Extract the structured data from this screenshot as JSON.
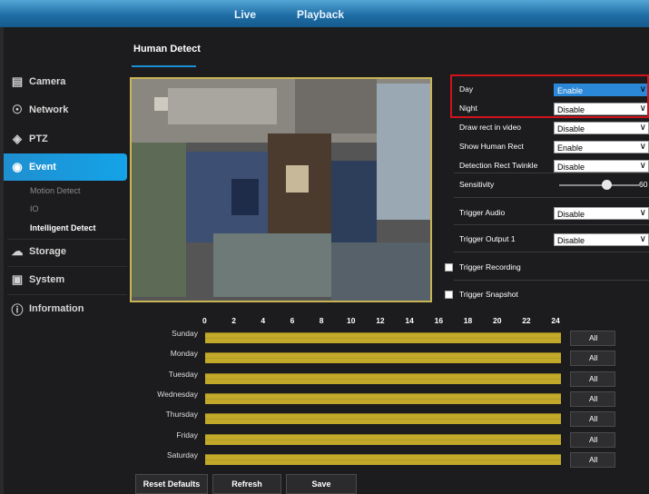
{
  "topnav": {
    "live": "Live",
    "playback": "Playback"
  },
  "sidebar": {
    "items": [
      {
        "label": "Camera",
        "icon": "camera-icon"
      },
      {
        "label": "Network",
        "icon": "network-globe-icon"
      },
      {
        "label": "PTZ",
        "icon": "ptz-icon"
      },
      {
        "label": "Event",
        "icon": "event-alarm-icon"
      },
      {
        "label": "Storage",
        "icon": "storage-cloud-icon"
      },
      {
        "label": "System",
        "icon": "system-monitor-icon"
      },
      {
        "label": "Information",
        "icon": "info-icon"
      }
    ],
    "event_sub": [
      "Motion Detect",
      "IO",
      "Intelligent Detect"
    ]
  },
  "page": {
    "title": "Human Detect"
  },
  "settings": {
    "day": {
      "label": "Day",
      "value": "Enable"
    },
    "night": {
      "label": "Night",
      "value": "Disable"
    },
    "draw_rect": {
      "label": "Draw rect in video",
      "value": "Disable"
    },
    "show_rect": {
      "label": "Show Human Rect",
      "value": "Enable"
    },
    "twinkle": {
      "label": "Detection Rect Twinkle",
      "value": "Disable"
    },
    "sensitivity": {
      "label": "Sensitivity",
      "value": "60",
      "level": 60
    },
    "trigger_audio": {
      "label": "Trigger Audio",
      "value": "Disable"
    },
    "trigger_output": {
      "label": "Trigger Output 1",
      "value": "Disable"
    },
    "trigger_recording": {
      "label": "Trigger Recording",
      "checked": false
    },
    "trigger_snapshot": {
      "label": "Trigger Snapshot",
      "checked": false
    }
  },
  "schedule": {
    "hours": [
      "0",
      "2",
      "4",
      "6",
      "8",
      "10",
      "12",
      "14",
      "16",
      "18",
      "20",
      "22",
      "24"
    ],
    "days": [
      "Sunday",
      "Monday",
      "Tuesday",
      "Wednesday",
      "Thursday",
      "Friday",
      "Saturday"
    ],
    "all_label": "All",
    "bar_color": "#c2a92a"
  },
  "buttons": {
    "reset": "Reset Defaults",
    "refresh": "Refresh",
    "save": "Save"
  },
  "colors": {
    "accent": "#1a8fd6",
    "highlight_box": "#d0141b"
  }
}
